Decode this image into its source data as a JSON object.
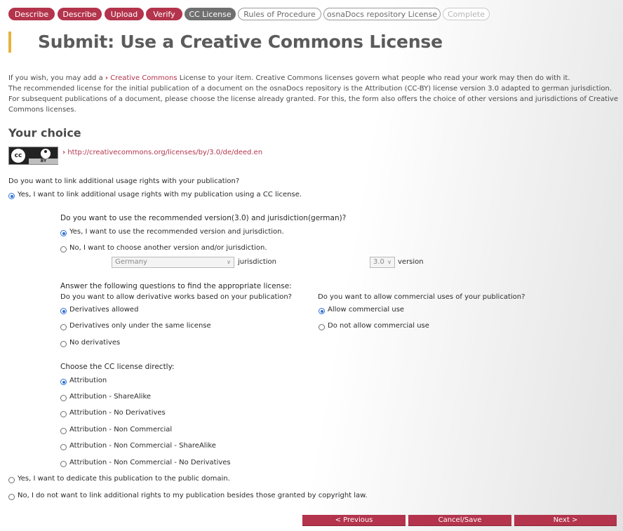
{
  "steps": {
    "describe1": "Describe",
    "describe2": "Describe",
    "upload": "Upload",
    "verify": "Verify",
    "cc_license": "CC License",
    "rules": "Rules of Procedure",
    "osnadocs": "osnaDocs repository License",
    "complete": "Complete"
  },
  "page_title": "Submit: Use a Creative Commons License",
  "intro": {
    "line1_pre": "If you wish, you may add a ",
    "line1_link": "Creative Commons",
    "line1_post": " License to your item. Creative Commons licenses govern what people who read your work may then do with it.",
    "line2": "The recommended license for the initial publication of a document on the osnaDocs repository is the Attribution (CC-BY) license version 3.0 adapted to german jurisdiction.",
    "line3": "For subsequent publications of a document, please choose the license already granted. For this, the form also offers the choice of other versions and jurisdictions of Creative",
    "line4": "Commons licenses."
  },
  "your_choice": {
    "heading": "Your choice",
    "badge_cc": "cc",
    "badge_by": "BY",
    "license_url": "http://creativecommons.org/licenses/by/3.0/de/deed.en"
  },
  "link_question": "Do you want to link additional usage rights with your publication?",
  "opt_yes_cc": "Yes, I want to link additional usage rights with my publication using a CC license.",
  "recommended": {
    "question": "Do you want to use the recommended version(3.0) and jurisdiction(german)?",
    "opt_yes": "Yes, I want to use the recommended version and jurisdiction.",
    "opt_no": "No, I want to choose another version and/or jurisdiction.",
    "jurisdiction_value": "Germany",
    "jurisdiction_label": "jurisdiction",
    "version_value": "3.0",
    "version_label": "version"
  },
  "questions": {
    "heading": "Answer the following questions to find the appropriate license:",
    "derivative_q": "Do you want to allow derivative works based on your publication?",
    "deriv_allowed": "Derivatives allowed",
    "deriv_same": "Derivatives only under the same license",
    "deriv_none": "No derivatives",
    "commercial_q": "Do you want to allow commercial uses of your publication?",
    "comm_allow": "Allow commercial use",
    "comm_disallow": "Do not allow commercial use"
  },
  "direct": {
    "heading": "Choose the CC license directly:",
    "options": [
      "Attribution",
      "Attribution - ShareAlike",
      "Attribution - No Derivatives",
      "Attribution - Non Commercial",
      "Attribution - Non Commercial - ShareAlike",
      "Attribution - Non Commercial - No Derivatives"
    ]
  },
  "opt_public_domain": "Yes, I want to dedicate this publication to the public domain.",
  "opt_no_rights": "No, I do not want to link additional rights to my publication besides those granted by copyright law.",
  "buttons": {
    "previous": "< Previous",
    "cancel": "Cancel/Save",
    "next": "Next >"
  },
  "colors": {
    "accent": "#b3344c",
    "title_bar": "#e8b33a",
    "radio_selected": "#2f6fd6"
  }
}
